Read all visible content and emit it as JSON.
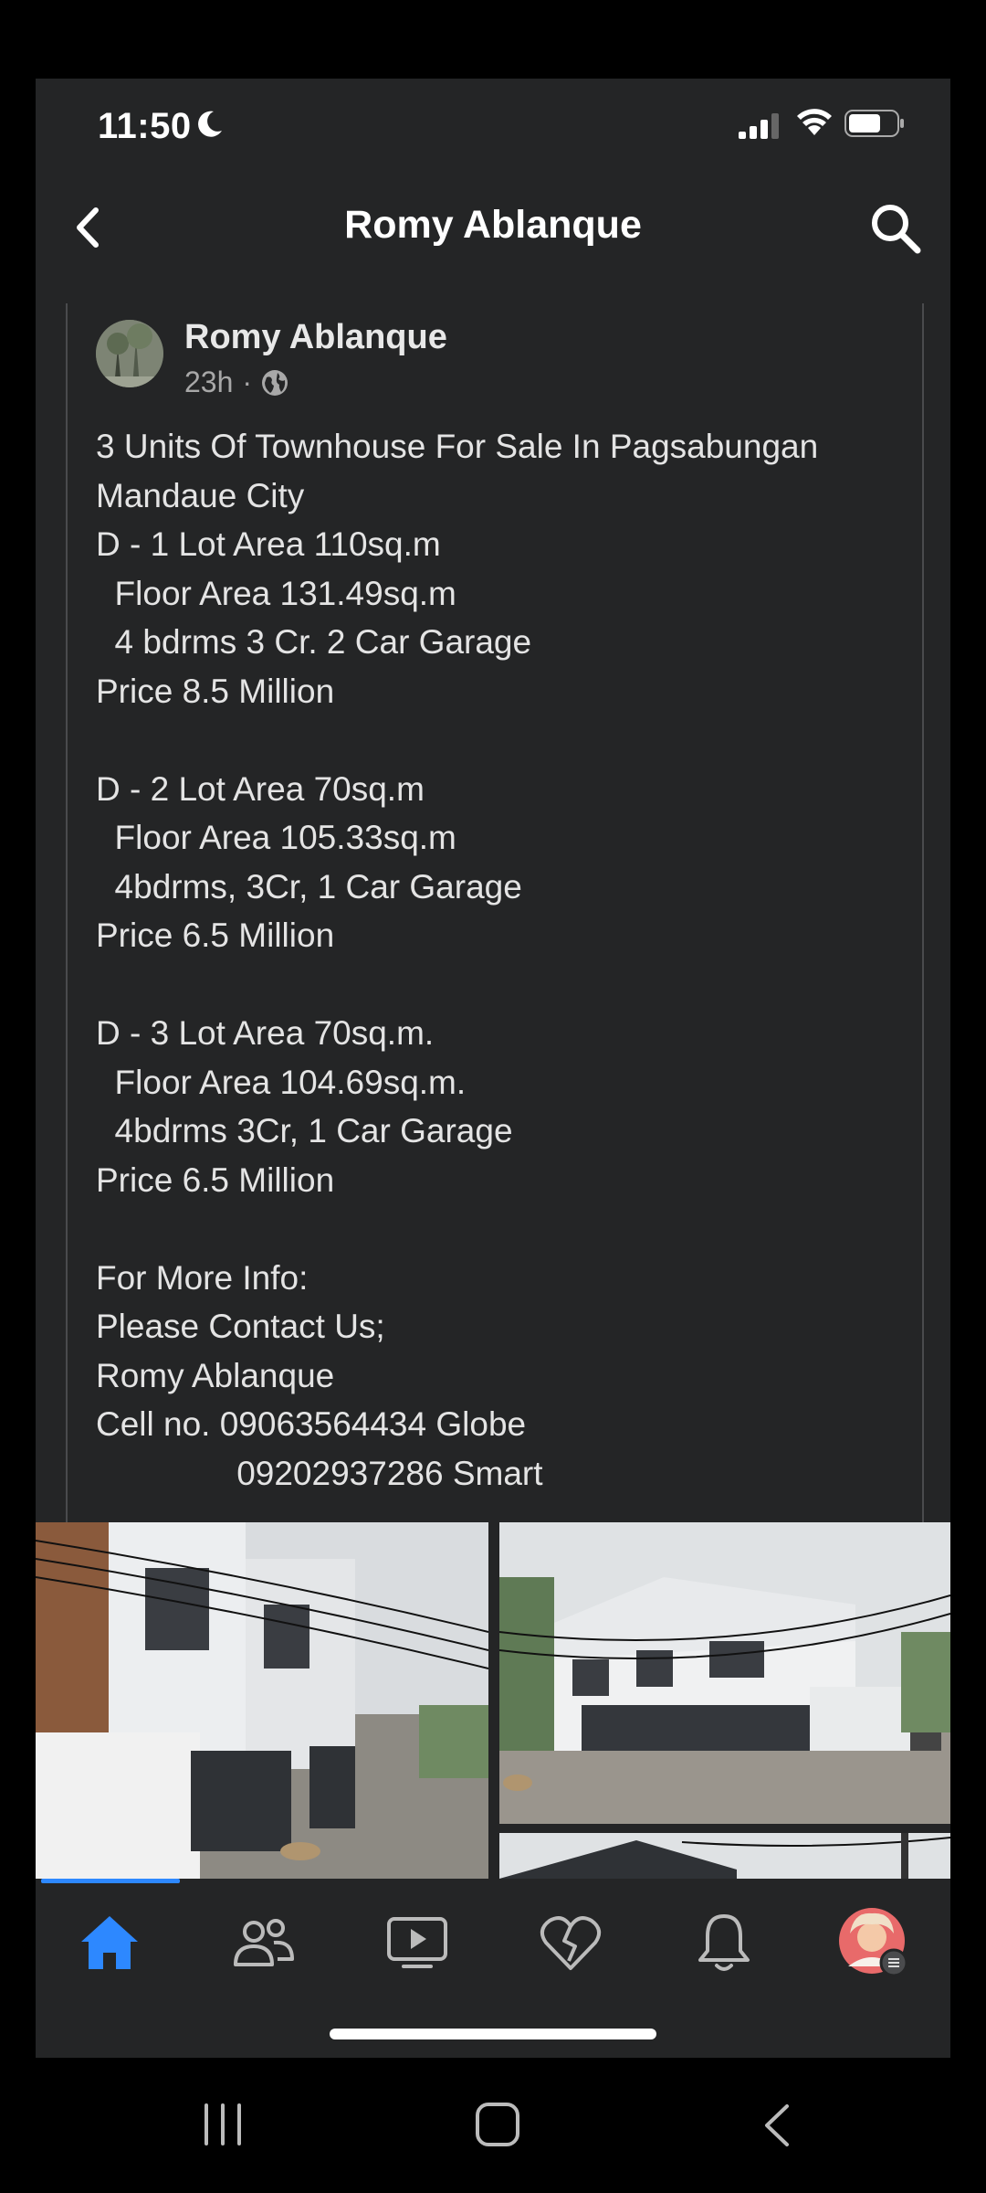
{
  "status_bar": {
    "time": "11:50"
  },
  "header": {
    "title": "Romy Ablanque"
  },
  "post": {
    "author": "Romy Ablanque",
    "time": "23h",
    "separator": "·",
    "lines": [
      "3 Units Of Townhouse For Sale In Pagsabungan",
      "Mandaue City",
      "D - 1 Lot Area 110sq.m",
      "  Floor Area 131.49sq.m",
      "  4 bdrms 3 Cr. 2 Car Garage",
      "Price 8.5 Million",
      "",
      "D - 2 Lot Area 70sq.m",
      "  Floor Area 105.33sq.m",
      "  4bdrms, 3Cr, 1 Car Garage",
      "Price 6.5 Million",
      "",
      "D - 3 Lot Area 70sq.m.",
      "  Floor Area 104.69sq.m.",
      "  4bdrms 3Cr, 1 Car Garage",
      "Price 6.5 Million",
      "",
      "For More Info:",
      "Please Contact Us;",
      "Romy Ablanque",
      "Cell no. 09063564434 Globe",
      "               09202937286 Smart"
    ]
  },
  "nav": {
    "items": [
      "home-icon",
      "friends-icon",
      "watch-icon",
      "dating-icon",
      "notifications-icon",
      "profile-avatar"
    ],
    "active": "home",
    "accent": "#2d88ff"
  },
  "colors": {
    "background": "#242526",
    "text": "#e4e4e4",
    "muted": "#a8a8a8"
  }
}
